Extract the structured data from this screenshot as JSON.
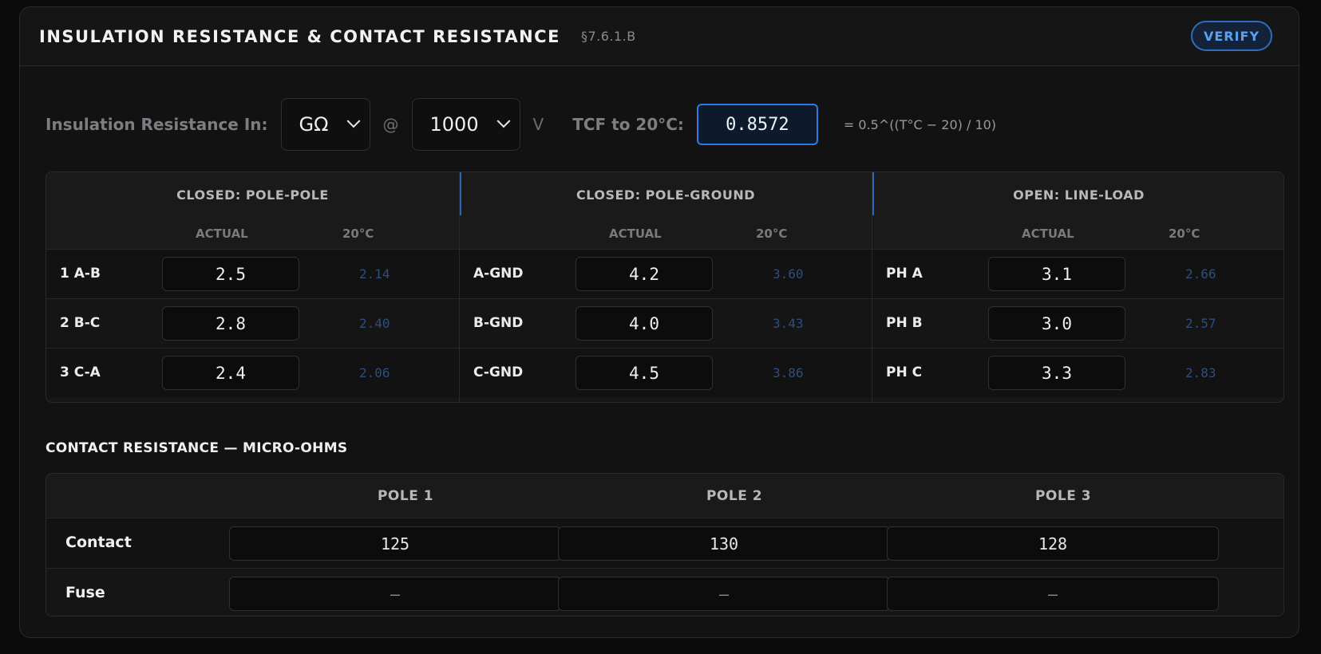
{
  "header": {
    "title": "INSULATION RESISTANCE & CONTACT RESISTANCE",
    "section_ref": "§7.6.1.B",
    "verify_label": "VERIFY"
  },
  "controls": {
    "ir_label": "Insulation Resistance In:",
    "unit_value": "GΩ",
    "at_symbol": "@",
    "voltage_value": "1000",
    "voltage_unit": "V",
    "tcf_label": "TCF to 20°C:",
    "tcf_value": "0.8572",
    "formula": "= 0.5^((T°C − 20) / 10)"
  },
  "insulation": {
    "col_actual": "ACTUAL",
    "col_20c": "20°C",
    "groups": [
      {
        "title": "CLOSED: POLE-POLE",
        "rows": [
          {
            "label": "1 A-B",
            "actual": "2.5",
            "corrected": "2.14"
          },
          {
            "label": "2 B-C",
            "actual": "2.8",
            "corrected": "2.40"
          },
          {
            "label": "3 C-A",
            "actual": "2.4",
            "corrected": "2.06"
          }
        ]
      },
      {
        "title": "CLOSED: POLE-GROUND",
        "rows": [
          {
            "label": "A-GND",
            "actual": "4.2",
            "corrected": "3.60"
          },
          {
            "label": "B-GND",
            "actual": "4.0",
            "corrected": "3.43"
          },
          {
            "label": "C-GND",
            "actual": "4.5",
            "corrected": "3.86"
          }
        ]
      },
      {
        "title": "OPEN: LINE-LOAD",
        "rows": [
          {
            "label": "PH A",
            "actual": "3.1",
            "corrected": "2.66"
          },
          {
            "label": "PH B",
            "actual": "3.0",
            "corrected": "2.57"
          },
          {
            "label": "PH C",
            "actual": "3.3",
            "corrected": "2.83"
          }
        ]
      }
    ]
  },
  "contact": {
    "title": "CONTACT RESISTANCE — MICRO-OHMS",
    "columns": [
      "POLE 1",
      "POLE 2",
      "POLE 3"
    ],
    "rows": [
      {
        "label": "Contact",
        "values": [
          "125",
          "130",
          "128"
        ]
      },
      {
        "label": "Fuse",
        "values": [
          "—",
          "—",
          "—"
        ]
      }
    ]
  },
  "colors": {
    "accent": "#2f7be0",
    "verify_text": "#5aa2f0",
    "corrected_text": "#2e4e7c"
  }
}
